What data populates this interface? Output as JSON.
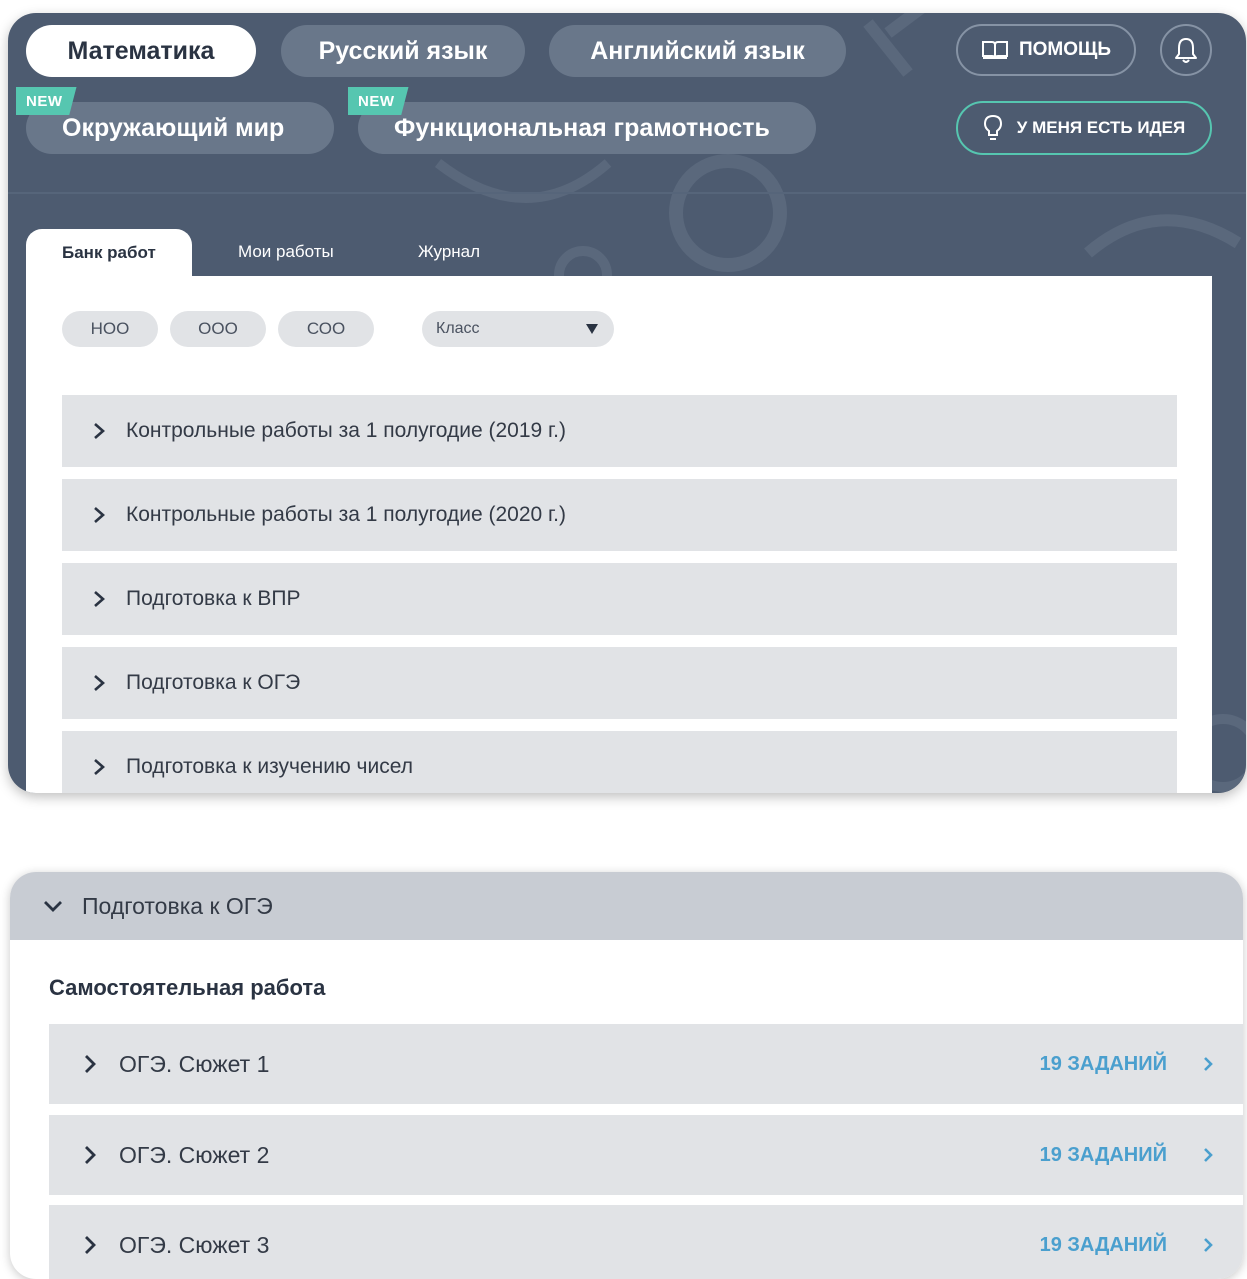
{
  "subjects": {
    "math": "Математика",
    "russian": "Русский язык",
    "english": "Английский язык",
    "world": "Окружающий мир",
    "literacy": "Функциональная грамотность",
    "new_badge": "NEW"
  },
  "header": {
    "help_label": "ПОМОЩЬ",
    "idea_label": "У МЕНЯ ЕСТЬ ИДЕЯ"
  },
  "tabs": {
    "bank": "Банк работ",
    "my_works": "Мои работы",
    "journal": "Журнал"
  },
  "filters": {
    "noo": "НОО",
    "ooo": "ООО",
    "soo": "СОО",
    "class_select_value": "Класс"
  },
  "categories": [
    "Контрольные работы за 1 полугодие (2019 г.)",
    "Контрольные работы за 1 полугодие (2020 г.)",
    "Подготовка к ВПР",
    "Подготовка к ОГЭ",
    "Подготовка к изучению чисел"
  ],
  "expanded": {
    "header": "Подготовка к ОГЭ",
    "section_title": "Самостоятельная работа",
    "items": [
      {
        "label": "ОГЭ. Сюжет 1",
        "count": "19 ЗАДАНИЙ"
      },
      {
        "label": "ОГЭ. Сюжет 2",
        "count": "19 ЗАДАНИЙ"
      },
      {
        "label": "ОГЭ. Сюжет 3",
        "count": "19 ЗАДАНИЙ"
      }
    ]
  },
  "colors": {
    "header_bg": "#4d5b70",
    "pill_bg": "#69778a",
    "accent_green": "#56c6b0",
    "accent_blue": "#4a9fce",
    "row_bg": "#e1e3e6"
  }
}
